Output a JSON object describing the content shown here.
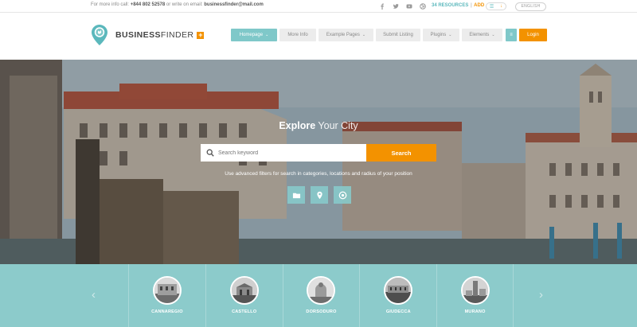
{
  "topbar": {
    "info_prefix": "For more info call:",
    "phone": "+844 802 52578",
    "info_middle": "or write on email:",
    "email": "businessfinder@mail.com",
    "social_icons": [
      "facebook-icon",
      "twitter-icon",
      "youtube-icon",
      "dribbble-icon"
    ],
    "resources_count": "34 RESOURCES",
    "resources_sep": "|",
    "add_label": "ADD",
    "toggle_a": "☰",
    "toggle_b": "↓",
    "language": "ENGLISH"
  },
  "logo": {
    "bold": "BUSINESS",
    "light": "FINDER",
    "plus": "+"
  },
  "nav": {
    "items": [
      {
        "label": "Homepage",
        "chevron": "⌄"
      },
      {
        "label": "More Info",
        "chevron": ""
      },
      {
        "label": "Example Pages",
        "chevron": "⌄"
      },
      {
        "label": "Submit Listing",
        "chevron": ""
      },
      {
        "label": "Plugins",
        "chevron": "⌄"
      },
      {
        "label": "Elements",
        "chevron": "⌄"
      }
    ],
    "menu_glyph": "≡",
    "login": "Login"
  },
  "hero": {
    "title_strong": "Explore",
    "title_light": "Your City",
    "search_placeholder": "Search keyword",
    "search_button": "Search",
    "subtitle": "Use advanced filters for search in categories, locations and radius of your position",
    "quick_icons": [
      "folder-icon",
      "map-pin-icon",
      "target-icon"
    ]
  },
  "strip": {
    "prev_glyph": "‹",
    "next_glyph": "›",
    "cities": [
      {
        "name": "CANNAREGIO"
      },
      {
        "name": "CASTELLO"
      },
      {
        "name": "DORSODURO"
      },
      {
        "name": "GIUDECCA"
      },
      {
        "name": "MURANO"
      }
    ]
  },
  "colors": {
    "accent_teal": "#7fc8c9",
    "accent_orange": "#f39200",
    "strip_bg": "#8ccbcb"
  }
}
